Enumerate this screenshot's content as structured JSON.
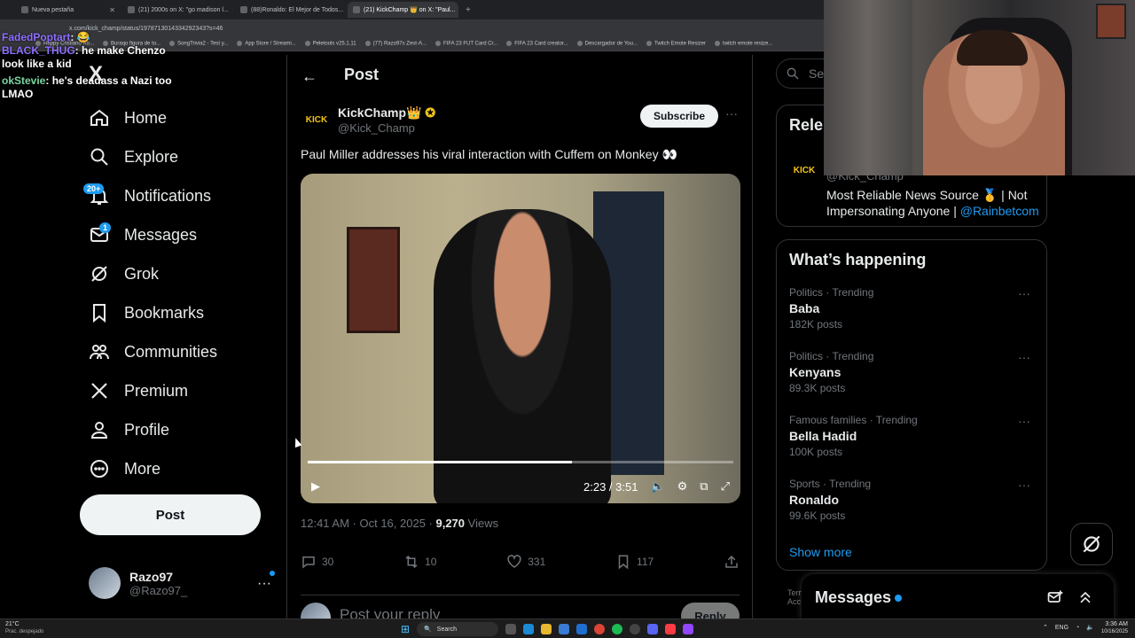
{
  "browser": {
    "tabs": [
      {
        "title": "Nueva pestaña",
        "active": false
      },
      {
        "title": "(21) 2000s on X: \"go madison l...",
        "active": false
      },
      {
        "title": "(88)Ronaldo: El Mejor de Todos...",
        "active": false
      },
      {
        "title": "(21) KickChamp 👑 on X: \"Paul...",
        "active": true
      }
    ],
    "new_tab": "+",
    "url": "x.com/kick_champ/status/1978713014334292343?s=46",
    "bookmarks": [
      "Happy Cristiano Ro...",
      "Buraqo figura de to...",
      "SongTrivia2 - Test y...",
      "App Store / Streami...",
      "Peletools v25.1.11",
      "(77) Razo97s Zest-A...",
      "FIFA 23 FUT Card Cr...",
      "FIFA 23 Card creator...",
      "Descargador de You...",
      "Twitch Emote Resizer",
      "twitch emote resize..."
    ]
  },
  "chat": [
    {
      "user": "FadedPoptart",
      "text": ": 😂",
      "color": "#8f6fff"
    },
    {
      "user": "BLACK_THUG",
      "text": ": he make Chenzo look like a kid",
      "color": "#8f6fff"
    },
    {
      "user": "okStevie",
      "text": ": he's deadass a Nazi too LMAO",
      "color": "#7ad5a0"
    }
  ],
  "nav": {
    "logo": "X",
    "items": [
      {
        "label": "Home",
        "icon": "home-icon"
      },
      {
        "label": "Explore",
        "icon": "search-icon"
      },
      {
        "label": "Notifications",
        "icon": "bell-icon",
        "badge": "20+"
      },
      {
        "label": "Messages",
        "icon": "mail-icon",
        "badge": "1"
      },
      {
        "label": "Grok",
        "icon": "grok-icon"
      },
      {
        "label": "Bookmarks",
        "icon": "bookmark-icon"
      },
      {
        "label": "Communities",
        "icon": "communities-icon"
      },
      {
        "label": "Premium",
        "icon": "x-logo-icon"
      },
      {
        "label": "Profile",
        "icon": "person-icon"
      },
      {
        "label": "More",
        "icon": "more-circle-icon"
      }
    ],
    "post_button": "Post",
    "account": {
      "name": "Razo97",
      "handle": "@Razo97_",
      "more": "···"
    }
  },
  "main": {
    "back": "←",
    "title": "Post",
    "author": {
      "name": "KickChamp👑",
      "handle": "@Kick_Champ",
      "avatar_text": "KICK",
      "verified": true
    },
    "subscribe": "Subscribe",
    "more": "···",
    "text": "Paul Miller addresses his viral interaction with Cuffem on Monkey 👀",
    "video": {
      "time": "2:23 / 3:51",
      "progress": 0.62
    },
    "meta": {
      "time": "12:41 AM · Oct 16, 2025 · ",
      "views_count": "9,270",
      "views_label": " Views"
    },
    "actions": {
      "replies": "30",
      "reposts": "10",
      "likes": "331",
      "bookmarks": "117"
    },
    "reply": {
      "placeholder": "Post your reply",
      "button": "Reply"
    }
  },
  "right": {
    "search_placeholder": "Sear",
    "relevant": {
      "title": "Rele",
      "handle": "@Kick_Champ",
      "avatar_text": "KICK",
      "bio": "Most Reliable News Source 🥇 | Not Impersonating Anyone | ",
      "bio_link": "@Rainbetcom"
    },
    "trends_title": "What’s happening",
    "trends": [
      {
        "category": "Politics · Trending",
        "name": "Baba",
        "count": "182K posts"
      },
      {
        "category": "Politics · Trending",
        "name": "Kenyans",
        "count": "89.3K posts"
      },
      {
        "category": "Famous families · Trending",
        "name": "Bella Hadid",
        "count": "100K posts"
      },
      {
        "category": "Sports · Trending",
        "name": "Ronaldo",
        "count": "99.6K posts"
      }
    ],
    "show_more": "Show more",
    "terms": "Terr",
    "terms2": "Acc",
    "messages": "Messages"
  },
  "taskbar": {
    "weather_temp": "21°C",
    "weather_desc": "Prac. despejado",
    "search": "Search",
    "lang": "ENG",
    "time": "3:36 AM",
    "date": "10/16/2025"
  }
}
